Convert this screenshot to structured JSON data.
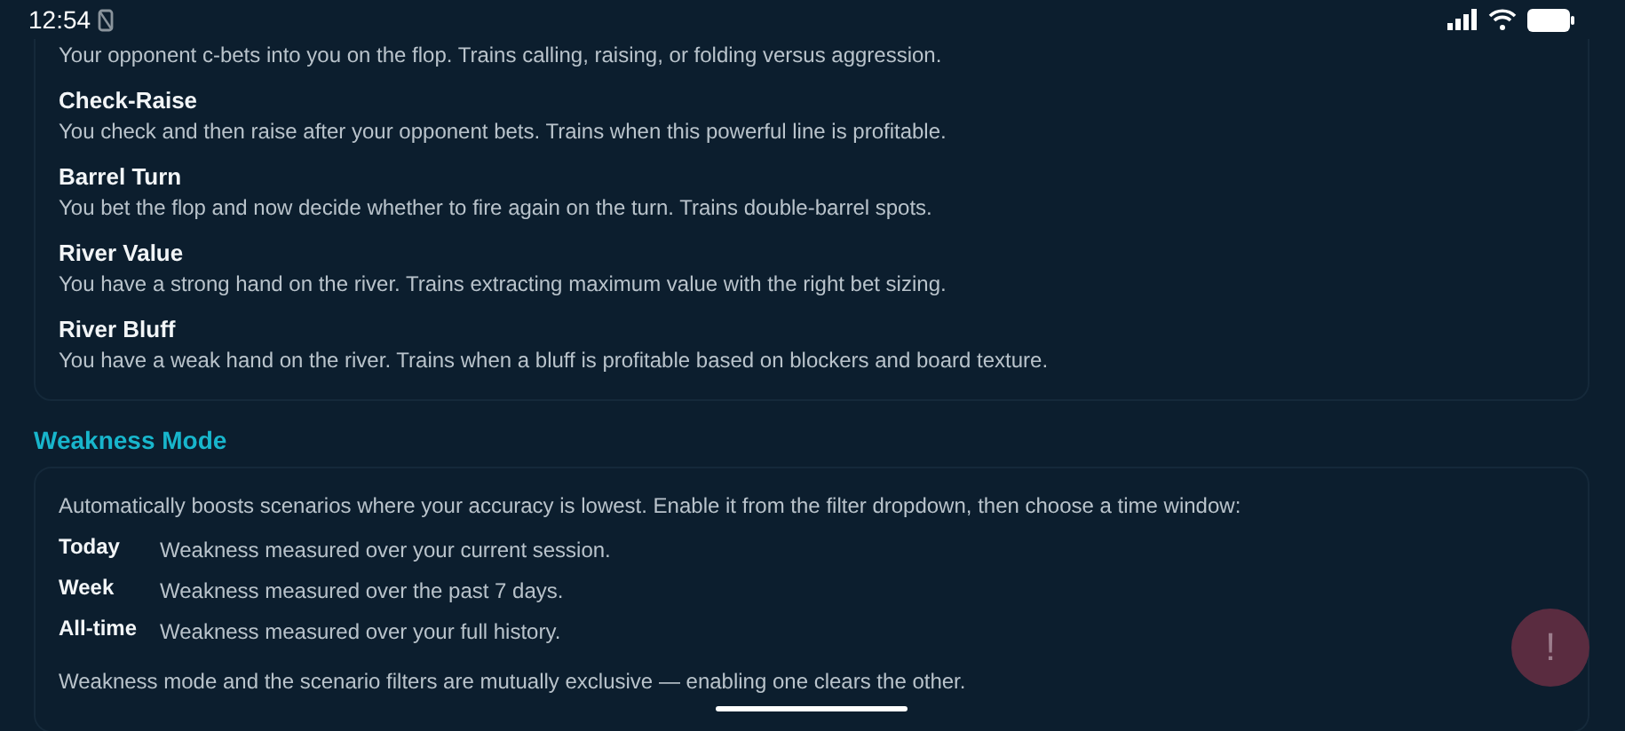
{
  "status_bar": {
    "time": "12:54"
  },
  "scenarios": [
    {
      "description": "Your opponent c-bets into you on the flop. Trains calling, raising, or folding versus aggression."
    },
    {
      "title": "Check-Raise",
      "description": "You check and then raise after your opponent bets. Trains when this powerful line is profitable."
    },
    {
      "title": "Barrel Turn",
      "description": "You bet the flop and now decide whether to fire again on the turn. Trains double-barrel spots."
    },
    {
      "title": "River Value",
      "description": "You have a strong hand on the river. Trains extracting maximum value with the right bet sizing."
    },
    {
      "title": "River Bluff",
      "description": "You have a weak hand on the river. Trains when a bluff is profitable based on blockers and board texture."
    }
  ],
  "weakness_mode": {
    "heading": "Weakness Mode",
    "intro": "Automatically boosts scenarios where your accuracy is lowest. Enable it from the filter dropdown, then choose a time window:",
    "windows": [
      {
        "term": "Today",
        "description": "Weakness measured over your current session."
      },
      {
        "term": "Week",
        "description": "Weakness measured over the past 7 days."
      },
      {
        "term": "All-time",
        "description": "Weakness measured over your full history."
      }
    ],
    "note": "Weakness mode and the scenario filters are mutually exclusive — enabling one clears the other."
  },
  "fab": {
    "label": "!"
  }
}
